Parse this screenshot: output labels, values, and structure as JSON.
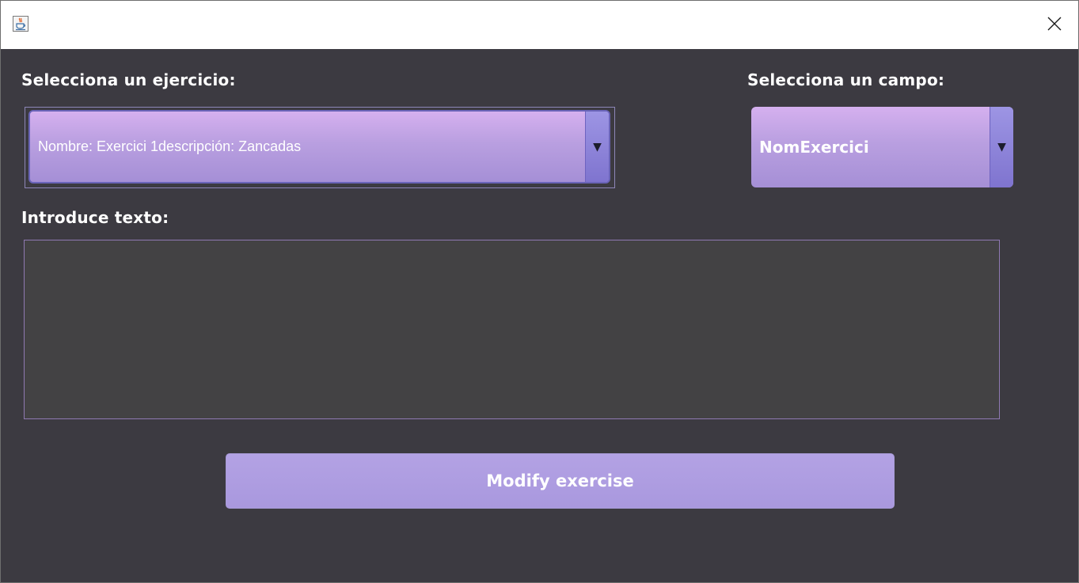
{
  "window": {
    "app_icon": "java-cup-icon",
    "close_glyph": "✕"
  },
  "form": {
    "exercise_label": "Selecciona un ejercicio:",
    "exercise_value": "Nombre: Exercici 1descripción: Zancadas",
    "field_label": "Selecciona un campo:",
    "field_value": "NomExercici",
    "text_label": "Introduce texto:",
    "text_value": "",
    "arrow_glyph": "▼",
    "submit_label": "Modify exercise"
  },
  "colors": {
    "background": "#3c3a41",
    "combo_accent": "#b99fe0",
    "button": "#ae9de1",
    "textarea_border": "#8f79b2"
  }
}
